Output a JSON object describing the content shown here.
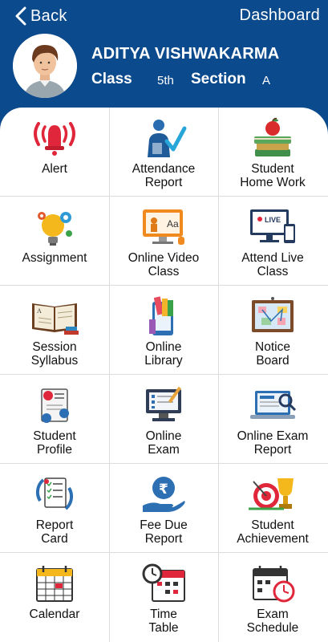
{
  "header": {
    "back_label": "Back",
    "dashboard_label": "Dashboard",
    "student_name": "ADITYA VISHWAKARMA",
    "class_label": "Class",
    "class_value": "5th",
    "section_label": "Section",
    "section_value": "A",
    "bg_color": "#0b4a8c"
  },
  "menu": [
    {
      "label": "Alert",
      "icon": "alarm-bell-icon"
    },
    {
      "label": "Attendance\nReport",
      "icon": "attendance-checkmark-icon"
    },
    {
      "label": "Student\nHome Work",
      "icon": "books-apple-icon"
    },
    {
      "label": "Assignment",
      "icon": "lightbulb-gears-icon"
    },
    {
      "label": "Online Video\nClass",
      "icon": "video-class-screen-icon"
    },
    {
      "label": "Attend Live\nClass",
      "icon": "live-monitor-icon"
    },
    {
      "label": "Session\nSyllabus",
      "icon": "open-book-icon"
    },
    {
      "label": "Online\nLibrary",
      "icon": "phone-books-icon"
    },
    {
      "label": "Notice\nBoard",
      "icon": "notice-board-icon"
    },
    {
      "label": "Student\nProfile",
      "icon": "profile-document-icon"
    },
    {
      "label": "Online\nExam",
      "icon": "online-exam-monitor-icon"
    },
    {
      "label": "Online Exam\nReport",
      "icon": "exam-report-laptop-icon"
    },
    {
      "label": "Report\nCard",
      "icon": "report-card-icon"
    },
    {
      "label": "Fee Due\nReport",
      "icon": "rupee-hand-icon"
    },
    {
      "label": "Student\nAchievement",
      "icon": "trophy-target-icon"
    },
    {
      "label": "Calendar",
      "icon": "calendar-icon"
    },
    {
      "label": "Time\nTable",
      "icon": "timetable-clock-icon"
    },
    {
      "label": "Exam\nSchedule",
      "icon": "exam-schedule-clock-icon"
    }
  ]
}
